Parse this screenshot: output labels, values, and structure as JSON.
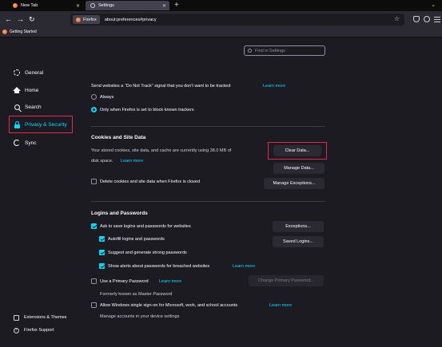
{
  "tabs": [
    {
      "label": "New Tab"
    },
    {
      "label": "Settings"
    }
  ],
  "urlbar": {
    "identity": "Firefox",
    "url": "about:preferences#privacy"
  },
  "bookmarks": [
    {
      "label": "Getting Started"
    }
  ],
  "search": {
    "placeholder": "Find in Settings"
  },
  "sidebar": {
    "items": [
      {
        "label": "General",
        "icon": "gear-icon"
      },
      {
        "label": "Home",
        "icon": "home-icon"
      },
      {
        "label": "Search",
        "icon": "search-icon"
      },
      {
        "label": "Privacy & Security",
        "icon": "lock-icon",
        "active": true
      },
      {
        "label": "Sync",
        "icon": "sync-icon"
      }
    ],
    "footer": [
      {
        "label": "Extensions & Themes",
        "icon": "puzzle-icon"
      },
      {
        "label": "Firefox Support",
        "icon": "help-icon"
      }
    ]
  },
  "dnt": {
    "text": "Send websites a “Do Not Track” signal that you don't want to be tracked",
    "learn_more": "Learn more",
    "options": [
      {
        "label": "Always",
        "selected": false
      },
      {
        "label": "Only when Firefox is set to block known trackers",
        "selected": true
      }
    ]
  },
  "cookies": {
    "heading": "Cookies and Site Data",
    "desc_line1": "Your stored cookies, site data, and cache are currently using 38.0 MB of",
    "desc_line2": "disk space.",
    "learn_more": "Learn more",
    "clear_label": "Clear Data...",
    "manage_label": "Manage Data...",
    "manage_exceptions_label": "Manage Exceptions...",
    "delete_on_close": {
      "label": "Delete cookies and site data when Firefox is closed",
      "checked": false
    }
  },
  "logins": {
    "heading": "Logins and Passwords",
    "ask_save": {
      "label": "Ask to save logins and passwords for websites",
      "checked": true
    },
    "autofill": {
      "label": "Autofill logins and passwords",
      "checked": true
    },
    "suggest": {
      "label": "Suggest and generate strong passwords",
      "checked": true
    },
    "alerts": {
      "label": "Show alerts about passwords for breached websites",
      "checked": true,
      "learn_more": "Learn more"
    },
    "primary": {
      "label": "Use a Primary Password",
      "checked": false,
      "learn_more": "Learn more",
      "sub": "Formerly known as Master Password",
      "change_label": "Change Primary Password..."
    },
    "sso": {
      "label": "Allow Windows single sign-on for Microsoft, work, and school accounts",
      "checked": false,
      "learn_more": "Learn more",
      "sub": "Manage accounts in your device settings"
    },
    "exceptions_label": "Exceptions...",
    "saved_logins_label": "Saved Logins..."
  },
  "colors": {
    "accent": "#00ddff",
    "highlight": "#e22850",
    "background": "#1c1b22"
  }
}
